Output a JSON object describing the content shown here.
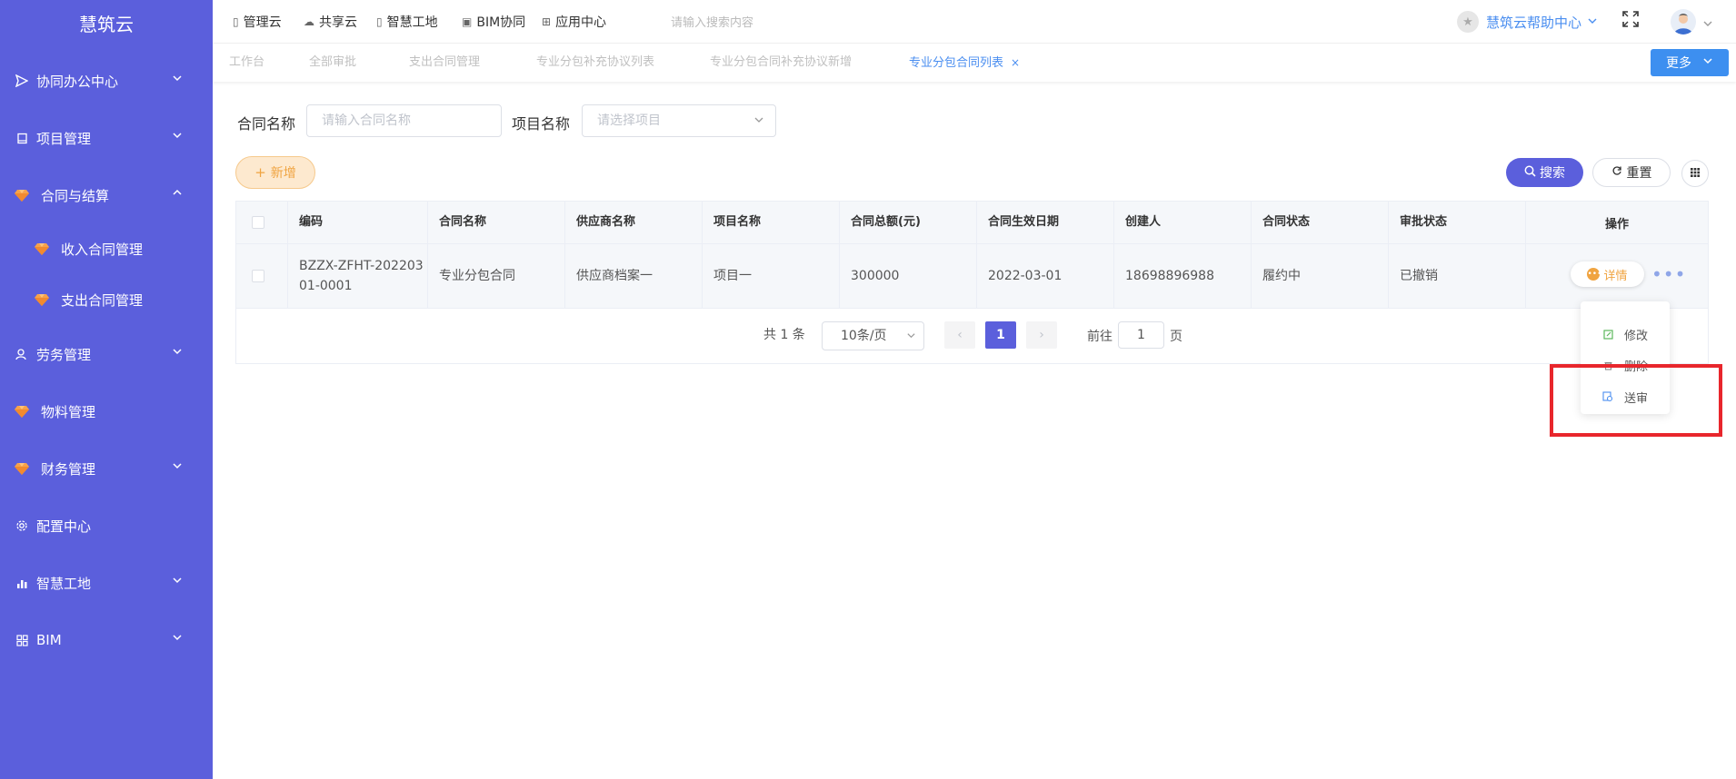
{
  "sidebar": {
    "brand": "慧筑云",
    "items": [
      {
        "label": "协同办公中心",
        "icon": "send-icon",
        "expandable": true
      },
      {
        "label": "项目管理",
        "icon": "book-icon",
        "expandable": true
      },
      {
        "label": "合同与结算",
        "icon": "gem-icon",
        "expandable": true,
        "expanded": true
      },
      {
        "label": "收入合同管理",
        "icon": "gem-icon",
        "sub": true
      },
      {
        "label": "支出合同管理",
        "icon": "gem-icon",
        "sub": true
      },
      {
        "label": "劳务管理",
        "icon": "user-icon",
        "expandable": true
      },
      {
        "label": "物料管理",
        "icon": "gem-icon"
      },
      {
        "label": "财务管理",
        "icon": "gem-icon",
        "expandable": true
      },
      {
        "label": "配置中心",
        "icon": "gear-icon"
      },
      {
        "label": "智慧工地",
        "icon": "bar-chart-icon",
        "expandable": true
      },
      {
        "label": "BIM",
        "icon": "grid-icon",
        "expandable": true
      }
    ]
  },
  "topnav": {
    "items": [
      "管理云",
      "共享云",
      "智慧工地",
      "BIM协同",
      "应用中心"
    ],
    "search_placeholder": "请输入搜索内容",
    "help": "慧筑云帮助中心"
  },
  "tabs": {
    "items": [
      "工作台",
      "全部审批",
      "支出合同管理",
      "专业分包补充协议列表",
      "专业分包合同补充协议新增",
      "专业分包合同列表"
    ],
    "active_index": 5,
    "more_label": "更多"
  },
  "filters": {
    "contract_name_label": "合同名称",
    "contract_name_placeholder": "请输入合同名称",
    "project_name_label": "项目名称",
    "project_name_placeholder": "请选择项目"
  },
  "actions": {
    "add": "新增",
    "search": "搜索",
    "reset": "重置"
  },
  "table": {
    "columns": [
      "编码",
      "合同名称",
      "供应商名称",
      "项目名称",
      "合同总额(元)",
      "合同生效日期",
      "创建人",
      "合同状态",
      "审批状态",
      "操作"
    ],
    "rows": [
      {
        "code_line1": "BZZX-ZFHT-202203",
        "code_line2": "01-0001",
        "contract_name": "专业分包合同",
        "supplier": "供应商档案一",
        "project": "项目一",
        "amount": "300000",
        "effective_date": "2022-03-01",
        "creator": "18698896988",
        "contract_status": "履约中",
        "approval_status": "已撤销",
        "detail_label": "详情"
      }
    ]
  },
  "pagination": {
    "total": "共 1 条",
    "page_size": "10条/页",
    "current_page": "1",
    "goto_prefix": "前往",
    "goto_value": "1",
    "goto_suffix": "页"
  },
  "dropdown": {
    "items": [
      "修改",
      "删除",
      "送审"
    ]
  },
  "colors": {
    "sidebar_bg": "#5b5fdc",
    "primary": "#5b5fdc",
    "link_blue": "#4a8ef0",
    "orange": "#f0a441",
    "highlight_red": "#e8262c"
  }
}
